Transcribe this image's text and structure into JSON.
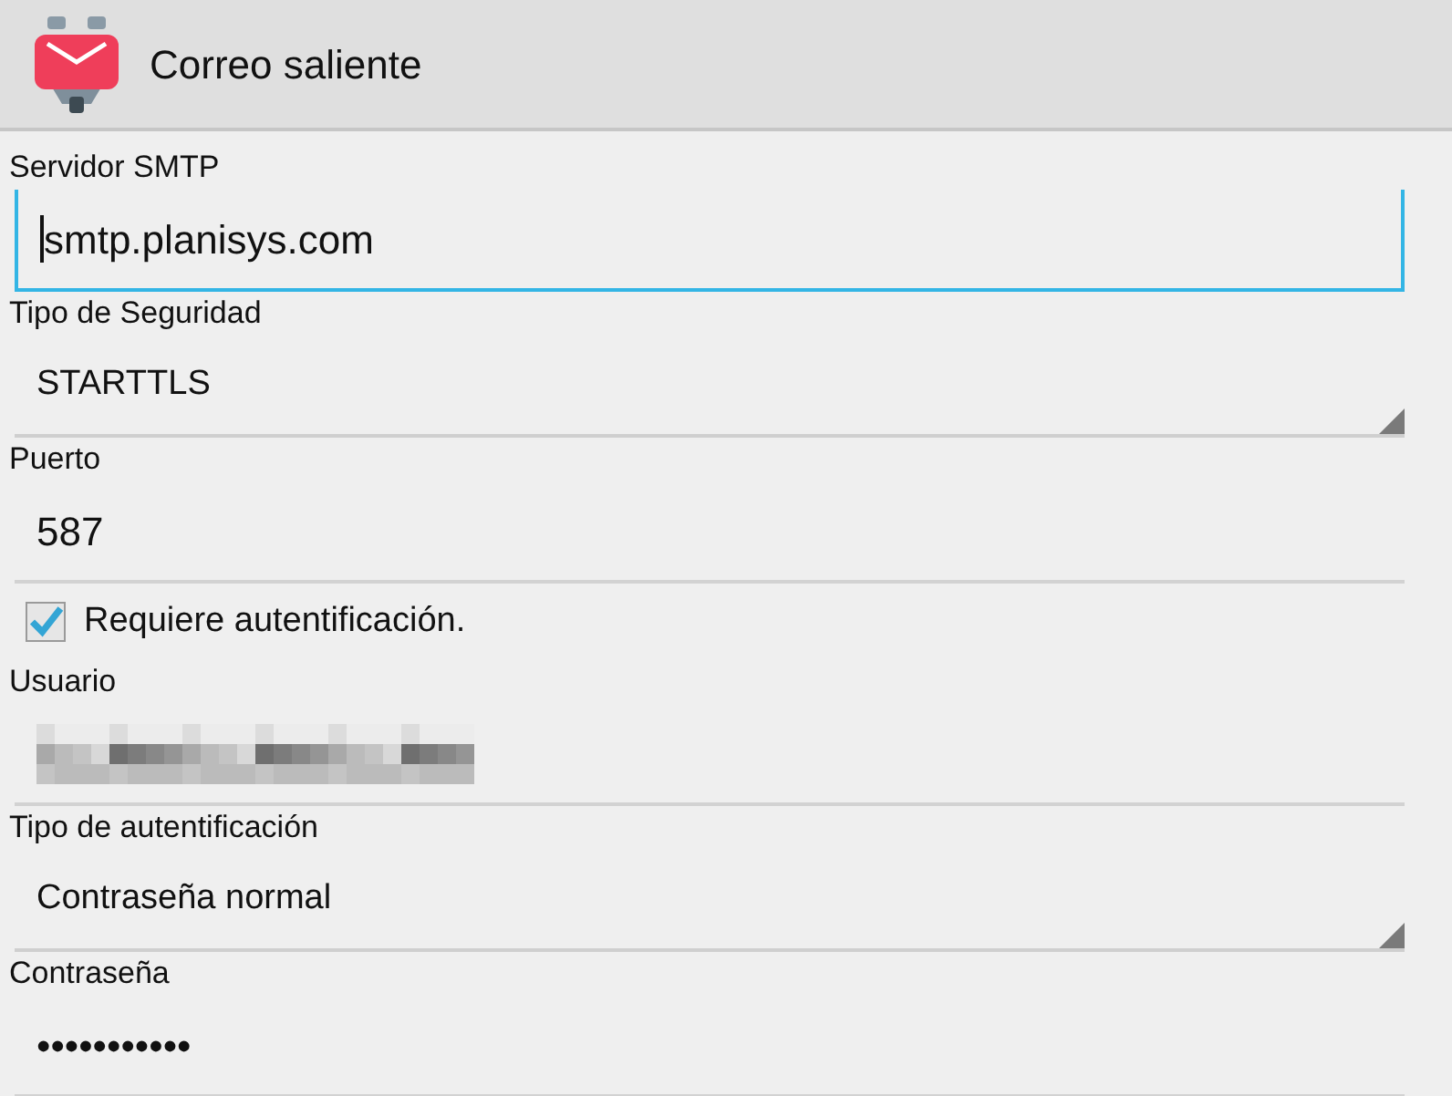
{
  "title": "Correo saliente",
  "fields": [
    {
      "kind": "text",
      "label": "Servidor SMTP",
      "value": "smtp.planisys.com",
      "focused": true
    },
    {
      "kind": "select",
      "label": "Tipo de Seguridad",
      "value": "STARTTLS"
    },
    {
      "kind": "text",
      "label": "Puerto",
      "value": "587",
      "focused": false
    },
    {
      "kind": "checkbox",
      "label": "Requiere autentificación.",
      "checked": true
    },
    {
      "kind": "redacted",
      "label": "Usuario",
      "focused": false
    },
    {
      "kind": "select",
      "label": "Tipo de autentificación",
      "value": "Contraseña normal"
    },
    {
      "kind": "text",
      "label": "Contraseña",
      "value": "•••••••••••",
      "focused": false
    }
  ]
}
